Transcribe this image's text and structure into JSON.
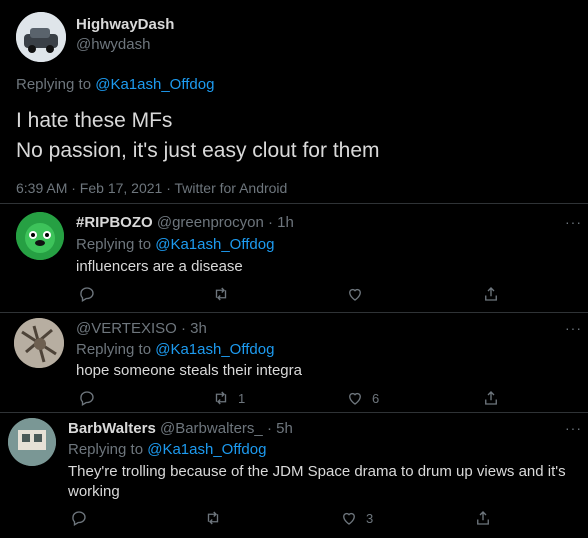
{
  "main_tweet": {
    "author_name": "HighwayDash",
    "author_handle": "@hwydash",
    "replying_label": "Replying to",
    "replying_to": "@Ka1ash_Offdog",
    "text_line1": "I hate these MFs",
    "text_line2": "No passion, it's just easy clout for them",
    "timestamp": "6:39 AM · Feb 17, 2021 · Twitter for Android"
  },
  "replies": [
    {
      "author_name": "#RIPBOZO",
      "author_handle": "@greenprocyon",
      "time": "· 1h",
      "replying_label": "Replying to",
      "replying_to": "@Ka1ash_Offdog",
      "text": "influencers are a disease",
      "retweet_count": "",
      "like_count": "",
      "more": "···"
    },
    {
      "author_name": "",
      "author_handle": "@VERTEXISO",
      "time": "· 3h",
      "replying_label": "Replying to",
      "replying_to": "@Ka1ash_Offdog",
      "text": "hope someone steals their integra",
      "retweet_count": "1",
      "like_count": "6",
      "more": "···"
    },
    {
      "author_name": "BarbWalters",
      "author_handle": "@Barbwalters_",
      "time": "· 5h",
      "replying_label": "Replying to",
      "replying_to": "@Ka1ash_Offdog",
      "text_line1": "They're trolling because of the JDM Space drama to drum up views and it's",
      "text_line2": "working",
      "retweet_count": "",
      "like_count": "3",
      "more": "···"
    }
  ],
  "icons": {
    "reply": "reply-icon",
    "retweet": "retweet-icon",
    "like": "like-icon",
    "share": "share-icon"
  },
  "colors": {
    "background": "#000000",
    "text": "#d9d9d9",
    "muted": "#6e767d",
    "mention": "#1d9bf0",
    "divider": "#2f3336"
  }
}
